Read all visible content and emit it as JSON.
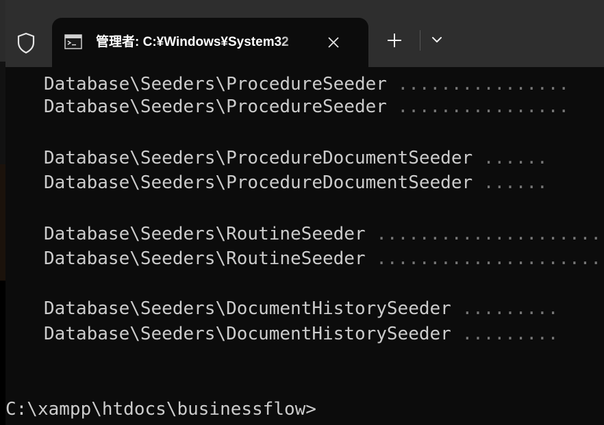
{
  "window": {
    "tab_title": "管理者: C:¥Windows¥System32",
    "icons": {
      "shield": "shield-icon",
      "tab": "terminal-app-icon",
      "close": "close-icon",
      "new_tab": "plus-icon",
      "dropdown": "chevron-down-icon"
    }
  },
  "terminal": {
    "lines": [
      {
        "text": "Database\\Seeders\\ProcedureSeeder",
        "dots": " ................"
      },
      {
        "text": "Database\\Seeders\\ProcedureSeeder",
        "dots": " ................"
      },
      {
        "text": "Database\\Seeders\\ProcedureDocumentSeeder",
        "dots": " ......"
      },
      {
        "text": "Database\\Seeders\\ProcedureDocumentSeeder",
        "dots": " ......"
      },
      {
        "text": "Database\\Seeders\\RoutineSeeder",
        "dots": " ....................."
      },
      {
        "text": "Database\\Seeders\\RoutineSeeder",
        "dots": " ....................."
      },
      {
        "text": "Database\\Seeders\\DocumentHistorySeeder",
        "dots": " ........."
      },
      {
        "text": "Database\\Seeders\\DocumentHistorySeeder",
        "dots": " ........."
      }
    ],
    "prompt": "C:\\xampp\\htdocs\\businessflow>"
  },
  "colors": {
    "titlebar": "#2e2e2e",
    "terminal_bg": "#0c0c0c",
    "text": "#cccccc",
    "dots": "#767676"
  }
}
